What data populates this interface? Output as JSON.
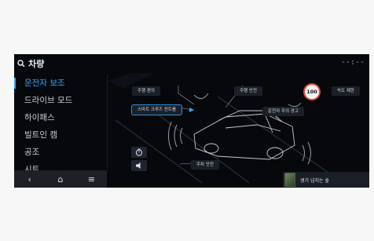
{
  "header": {
    "search_label": "차량",
    "clock": "--:--"
  },
  "sidebar": {
    "items": [
      {
        "label": "운전자 보조",
        "active": true
      },
      {
        "label": "드라이브 모드"
      },
      {
        "label": "하이패스"
      },
      {
        "label": "빌트인 캠"
      },
      {
        "label": "공조"
      },
      {
        "label": "시트"
      }
    ]
  },
  "navbar": {
    "back": "‹",
    "home": "⌂",
    "menu": "≡"
  },
  "scene": {
    "labels": {
      "driving_convenience": "주행 편의",
      "smart_cruise": "스마트 크루즈 컨트롤",
      "driving_safety": "주행 안전",
      "driver_attention": "운전자 주의 경고",
      "speed_limit": "속도 제한",
      "parking_safety": "주차 안전"
    },
    "speed_badge": "100"
  },
  "media": {
    "title": "생기 넘치는 숲"
  },
  "colors": {
    "accent": "#2aa7ff",
    "badge_ring": "#d94a3a",
    "screen_bg": "#06080c"
  }
}
